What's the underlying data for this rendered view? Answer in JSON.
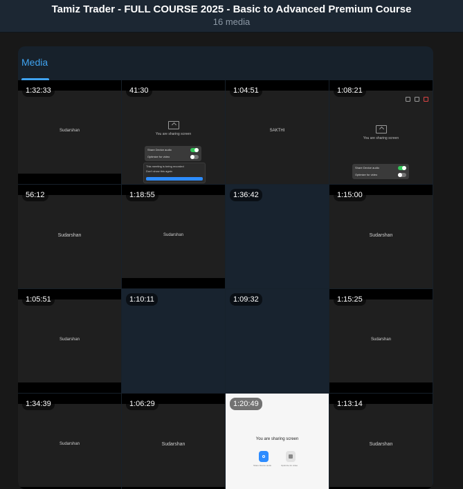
{
  "header": {
    "title": "Tamiz Trader - FULL COURSE 2025 - Basic to Advanced Premium Course",
    "subtitle": "16 media"
  },
  "tabs": [
    {
      "label": "Media",
      "active": true
    }
  ],
  "colors": {
    "accent": "#3fa3f0",
    "panel": "#17212b",
    "background": "#181818"
  },
  "media": [
    {
      "duration": "1:32:33",
      "caption": "Sudarshan",
      "style": "dark"
    },
    {
      "duration": "41:30",
      "style": "share-dialog",
      "share_text": "You are sharing screen",
      "option_1": "Share Device audio",
      "option_2": "Optimize for video",
      "record_text": "This meeting is being recorded",
      "dont_show": "Don't show this again"
    },
    {
      "duration": "1:04:51",
      "caption": "SAKTHI",
      "style": "dark"
    },
    {
      "duration": "1:08:21",
      "style": "share-plain",
      "share_text": "You are sharing screen",
      "option_1": "Share Device audio",
      "option_2": "Optimize for video"
    },
    {
      "duration": "56:12",
      "caption": "Sudarshan",
      "style": "dark-big"
    },
    {
      "duration": "1:18:55",
      "caption": "Sudarshan",
      "style": "dark"
    },
    {
      "duration": "1:36:42",
      "style": "blue"
    },
    {
      "duration": "1:15:00",
      "caption": "Sudarshan",
      "style": "dark-big"
    },
    {
      "duration": "1:05:51",
      "caption": "Sudarshan",
      "style": "dark"
    },
    {
      "duration": "1:10:11",
      "style": "blue"
    },
    {
      "duration": "1:09:32",
      "style": "blue"
    },
    {
      "duration": "1:15:25",
      "caption": "Sudarshan",
      "style": "dark"
    },
    {
      "duration": "1:34:39",
      "caption": "Sudarshan",
      "style": "dark"
    },
    {
      "duration": "1:06:29",
      "caption": "Sudarshan",
      "style": "dark-big"
    },
    {
      "duration": "1:20:49",
      "style": "white",
      "share_text": "You are sharing screen",
      "btn_1": "Share Device audio",
      "btn_2": "Optimize for video"
    },
    {
      "duration": "1:13:14",
      "caption": "Sudarshan",
      "style": "dark-big"
    }
  ]
}
